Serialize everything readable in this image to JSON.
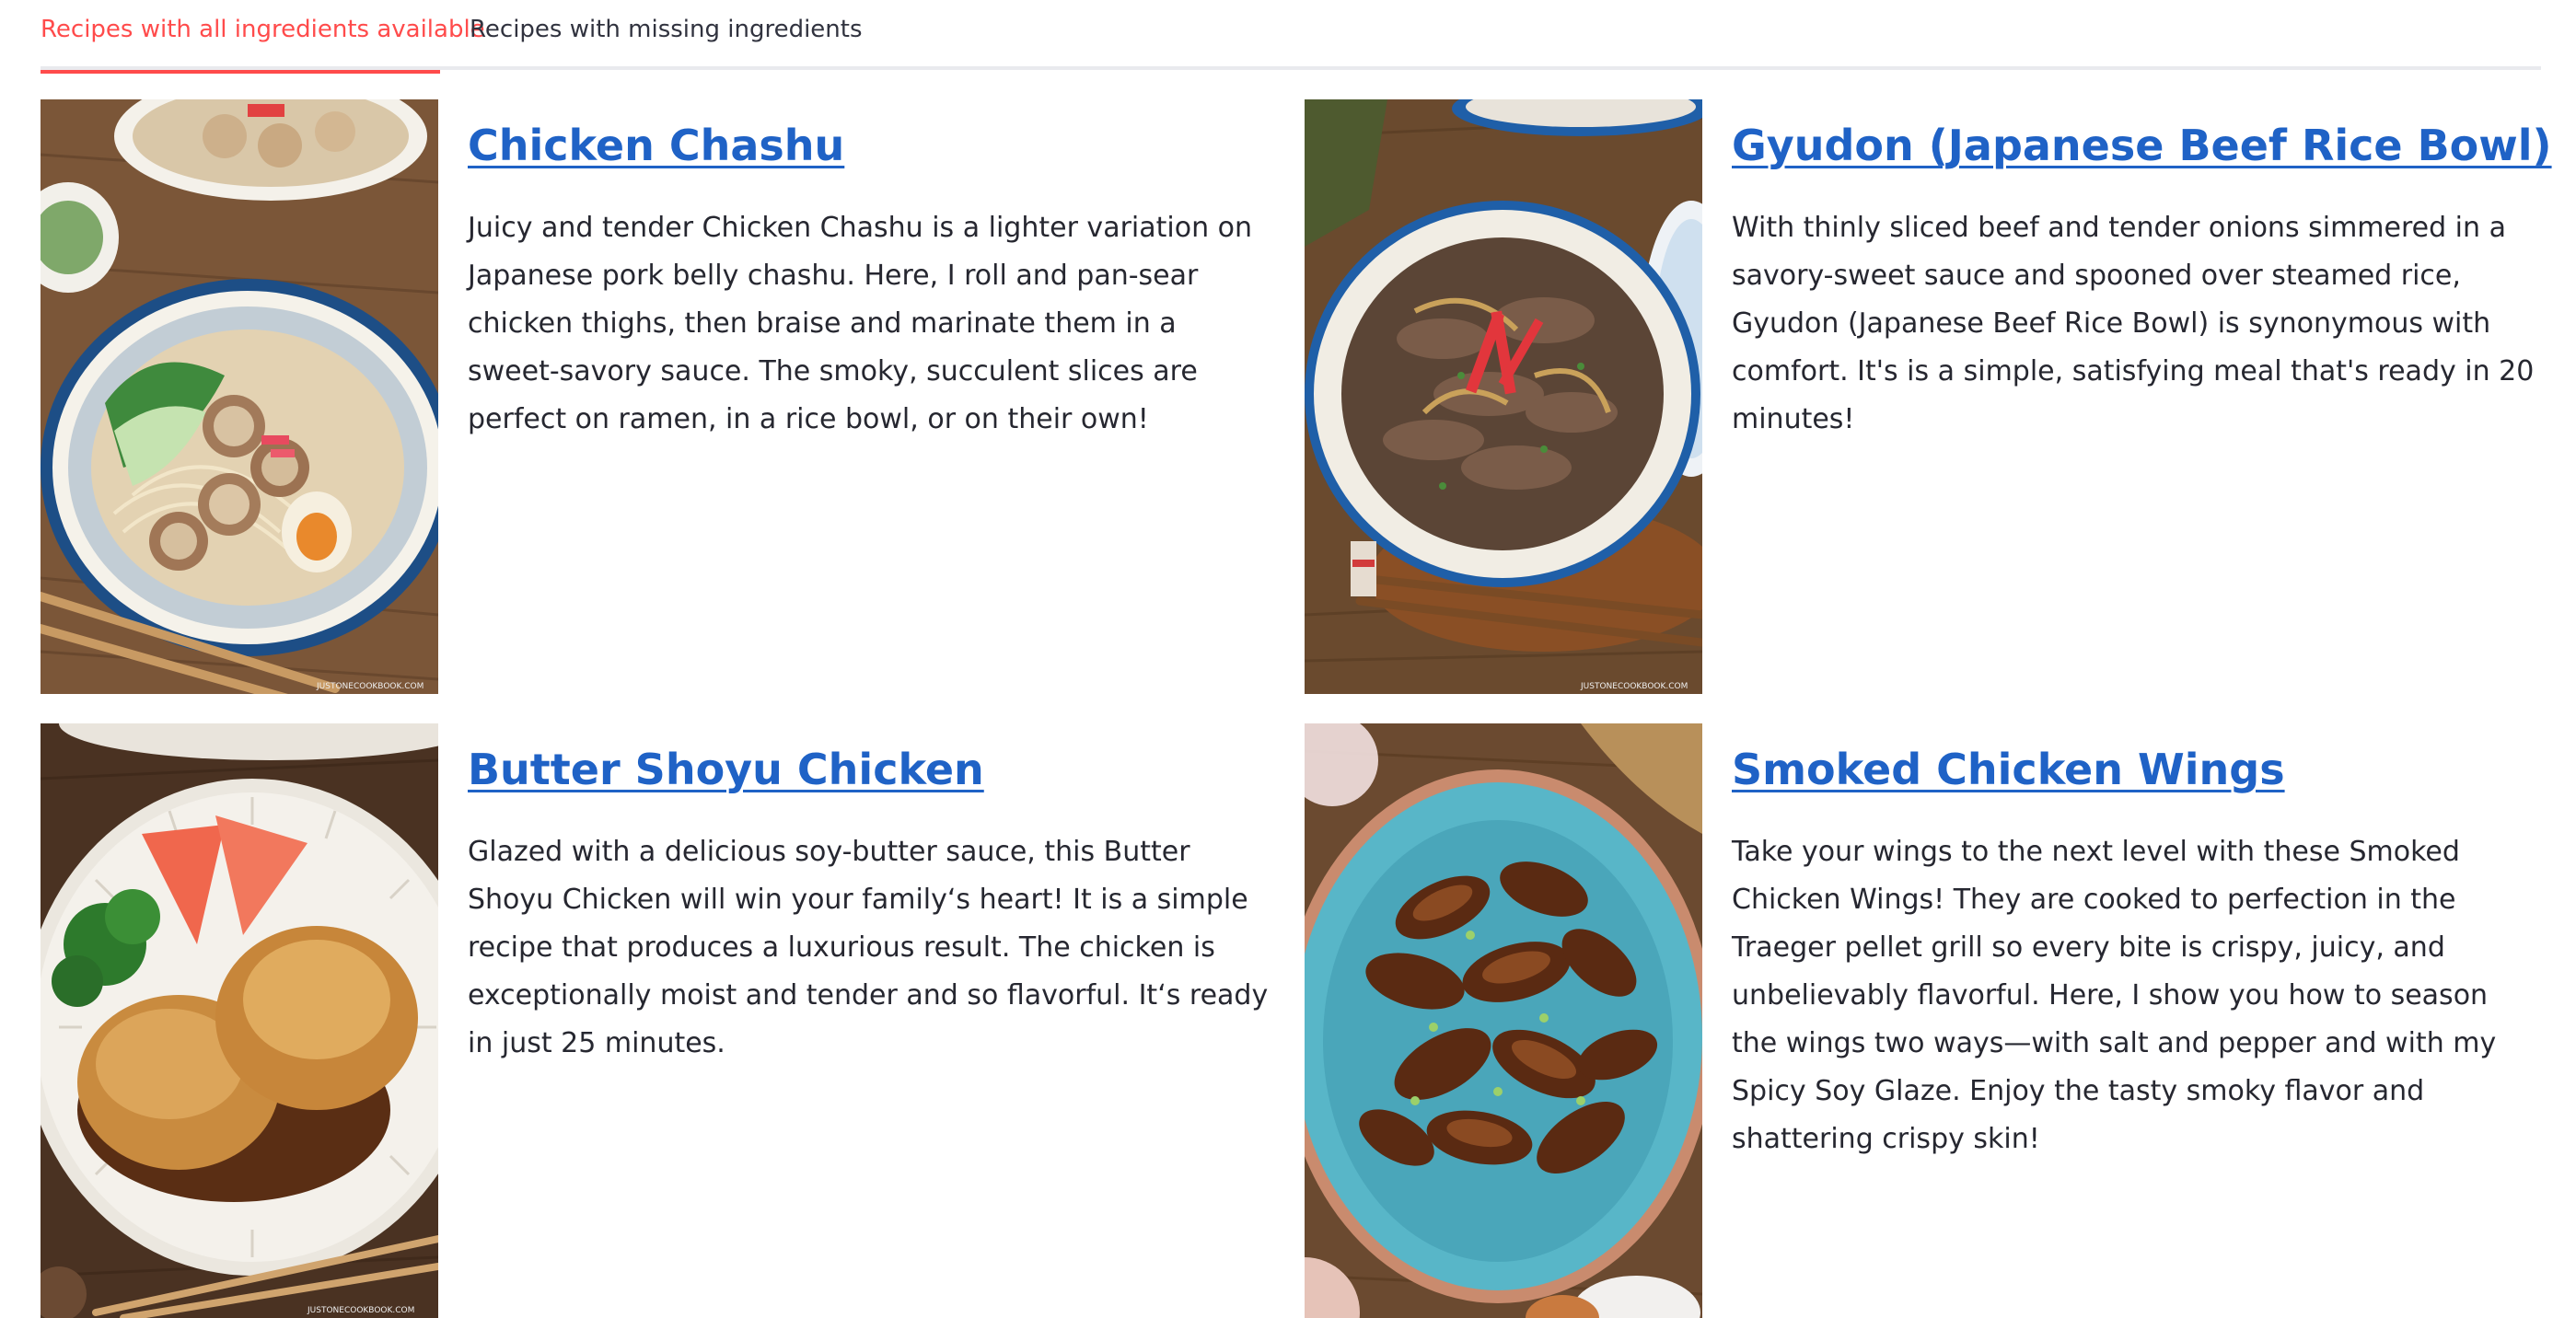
{
  "tabs": [
    {
      "label": "Recipes with all ingredients available",
      "active": true
    },
    {
      "label": "Recipes with missing ingredients",
      "active": false
    }
  ],
  "colors": {
    "accent": "#ff4b4b",
    "link": "#1f62c6",
    "text": "#262730",
    "tab_border": "#e9eaee"
  },
  "recipes": [
    {
      "title": "Chicken Chashu",
      "description": "Juicy and tender Chicken Chashu is a lighter variation on Japanese pork belly chashu. Here, I roll and pan-sear chicken thighs, then braise and marinate them in a sweet-savory sauce. The smoky, succulent slices are perfect on ramen, in a rice bowl, or on their own!",
      "image_icon": "ramen-bowl-photo",
      "watermark": "JUSTONECOOKBOOK.COM"
    },
    {
      "title": "Gyudon (Japanese Beef Rice Bowl)",
      "description": "With thinly sliced beef and tender onions simmered in a savory-sweet sauce and spooned over steamed rice, Gyudon (Japanese Beef Rice Bowl) is synonymous with comfort. It's is a simple, satisfying meal that's ready in 20 minutes!",
      "image_icon": "beef-bowl-photo",
      "watermark": "JUSTONECOOKBOOK.COM"
    },
    {
      "title": "Butter Shoyu Chicken",
      "description": "Glazed with a delicious soy-butter sauce, this Butter Shoyu Chicken will win your family‘s heart! It is a simple recipe that produces a luxurious result. The chicken is exceptionally moist and tender and so flavorful. It‘s ready in just 25 minutes.",
      "image_icon": "chicken-plate-photo",
      "watermark": "JUSTONECOOKBOOK.COM"
    },
    {
      "title": "Smoked Chicken Wings",
      "description": "Take your wings to the next level with these Smoked Chicken Wings! They are cooked to perfection in the Traeger pellet grill so every bite is crispy, juicy, and unbelievably flavorful. Here, I show you how to season the wings two ways—with salt and pepper and with my Spicy Soy Glaze. Enjoy the tasty smoky flavor and shattering crispy skin!",
      "image_icon": "chicken-wings-photo",
      "watermark": ""
    }
  ]
}
